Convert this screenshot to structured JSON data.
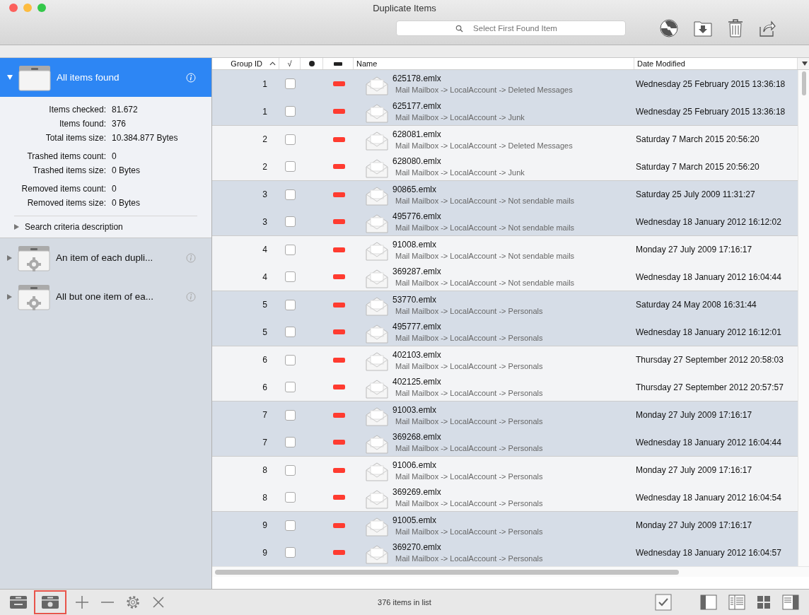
{
  "window": {
    "title": "Duplicate Items"
  },
  "search": {
    "placeholder": "Select First Found Item"
  },
  "sidebar": {
    "items": [
      {
        "title": "All items found",
        "selected": true,
        "expanded": true,
        "kind": "plain",
        "detail_groups": [
          [
            {
              "label": "Items checked:",
              "value": "81.672"
            },
            {
              "label": "Items found:",
              "value": "376"
            },
            {
              "label": "Total items size:",
              "value": "10.384.877 Bytes"
            }
          ],
          [
            {
              "label": "Trashed items count:",
              "value": "0"
            },
            {
              "label": "Trashed items size:",
              "value": "0 Bytes"
            }
          ],
          [
            {
              "label": "Removed items count:",
              "value": "0"
            },
            {
              "label": "Removed items size:",
              "value": "0 Bytes"
            }
          ]
        ],
        "criteria": {
          "label": "Search criteria description",
          "expanded": false
        }
      },
      {
        "title": "An item of each dupli...",
        "selected": false,
        "expanded": false,
        "kind": "gear"
      },
      {
        "title": "All but one item of ea...",
        "selected": false,
        "expanded": false,
        "kind": "gear"
      }
    ]
  },
  "table": {
    "columns": [
      {
        "kind": "text",
        "label": "Group ID"
      },
      {
        "kind": "text",
        "label": "√"
      },
      {
        "kind": "dot"
      },
      {
        "kind": "bar"
      },
      {
        "kind": "text",
        "label": "Name"
      },
      {
        "kind": "text",
        "label": "Date Modified"
      }
    ],
    "rows": [
      {
        "group": "1",
        "shaded": true,
        "checked": false,
        "color": "#ff3b30",
        "name": "625178.emlx",
        "path": "Mail Mailbox -> LocalAccount -> Deleted Messages",
        "date": "Wednesday 25 February 2015 13:36:18"
      },
      {
        "group": "1",
        "shaded": true,
        "checked": false,
        "color": "#ff3b30",
        "name": "625177.emlx",
        "path": "Mail Mailbox -> LocalAccount -> Junk",
        "date": "Wednesday 25 February 2015 13:36:18"
      },
      {
        "group": "2",
        "shaded": false,
        "checked": false,
        "color": "#ff3b30",
        "name": "628081.emlx",
        "path": "Mail Mailbox -> LocalAccount -> Deleted Messages",
        "date": "Saturday 7 March 2015 20:56:20"
      },
      {
        "group": "2",
        "shaded": false,
        "checked": false,
        "color": "#ff3b30",
        "name": "628080.emlx",
        "path": "Mail Mailbox -> LocalAccount -> Junk",
        "date": "Saturday 7 March 2015 20:56:20"
      },
      {
        "group": "3",
        "shaded": true,
        "checked": false,
        "color": "#ff3b30",
        "name": "90865.emlx",
        "path": "Mail Mailbox -> LocalAccount -> Not sendable mails",
        "date": "Saturday 25 July 2009 11:31:27"
      },
      {
        "group": "3",
        "shaded": true,
        "checked": false,
        "color": "#ff3b30",
        "name": "495776.emlx",
        "path": "Mail Mailbox -> LocalAccount -> Not sendable mails",
        "date": "Wednesday 18 January 2012 16:12:02"
      },
      {
        "group": "4",
        "shaded": false,
        "checked": false,
        "color": "#ff3b30",
        "name": "91008.emlx",
        "path": "Mail Mailbox -> LocalAccount -> Not sendable mails",
        "date": "Monday 27 July 2009 17:16:17"
      },
      {
        "group": "4",
        "shaded": false,
        "checked": false,
        "color": "#ff3b30",
        "name": "369287.emlx",
        "path": "Mail Mailbox -> LocalAccount -> Not sendable mails",
        "date": "Wednesday 18 January 2012 16:04:44"
      },
      {
        "group": "5",
        "shaded": true,
        "checked": false,
        "color": "#ff3b30",
        "name": "53770.emlx",
        "path": "Mail Mailbox -> LocalAccount -> Personals",
        "date": "Saturday 24 May 2008 16:31:44"
      },
      {
        "group": "5",
        "shaded": true,
        "checked": false,
        "color": "#ff3b30",
        "name": "495777.emlx",
        "path": "Mail Mailbox -> LocalAccount -> Personals",
        "date": "Wednesday 18 January 2012 16:12:01"
      },
      {
        "group": "6",
        "shaded": false,
        "checked": false,
        "color": "#ff3b30",
        "name": "402103.emlx",
        "path": "Mail Mailbox -> LocalAccount -> Personals",
        "date": "Thursday 27 September 2012 20:58:03"
      },
      {
        "group": "6",
        "shaded": false,
        "checked": false,
        "color": "#ff3b30",
        "name": "402125.emlx",
        "path": "Mail Mailbox -> LocalAccount -> Personals",
        "date": "Thursday 27 September 2012 20:57:57"
      },
      {
        "group": "7",
        "shaded": true,
        "checked": false,
        "color": "#ff3b30",
        "name": "91003.emlx",
        "path": "Mail Mailbox -> LocalAccount -> Personals",
        "date": "Monday 27 July 2009 17:16:17"
      },
      {
        "group": "7",
        "shaded": true,
        "checked": false,
        "color": "#ff3b30",
        "name": "369268.emlx",
        "path": "Mail Mailbox -> LocalAccount -> Personals",
        "date": "Wednesday 18 January 2012 16:04:44"
      },
      {
        "group": "8",
        "shaded": false,
        "checked": false,
        "color": "#ff3b30",
        "name": "91006.emlx",
        "path": "Mail Mailbox -> LocalAccount -> Personals",
        "date": "Monday 27 July 2009 17:16:17"
      },
      {
        "group": "8",
        "shaded": false,
        "checked": false,
        "color": "#ff3b30",
        "name": "369269.emlx",
        "path": "Mail Mailbox -> LocalAccount -> Personals",
        "date": "Wednesday 18 January 2012 16:04:54"
      },
      {
        "group": "9",
        "shaded": true,
        "checked": false,
        "color": "#ff3b30",
        "name": "91005.emlx",
        "path": "Mail Mailbox -> LocalAccount -> Personals",
        "date": "Monday 27 July 2009 17:16:17"
      },
      {
        "group": "9",
        "shaded": true,
        "checked": false,
        "color": "#ff3b30",
        "name": "369270.emlx",
        "path": "Mail Mailbox -> LocalAccount -> Personals",
        "date": "Wednesday 18 January 2012 16:04:57"
      }
    ]
  },
  "bottom_tools": [
    {
      "kind": "box-wrench",
      "highlighted": false
    },
    {
      "kind": "box-gear",
      "highlighted": true
    },
    {
      "kind": "plus",
      "highlighted": false
    },
    {
      "kind": "minus",
      "highlighted": false
    },
    {
      "kind": "gear",
      "highlighted": false
    },
    {
      "kind": "close",
      "highlighted": false
    }
  ],
  "status_bar": {
    "text": "376 items in list"
  }
}
